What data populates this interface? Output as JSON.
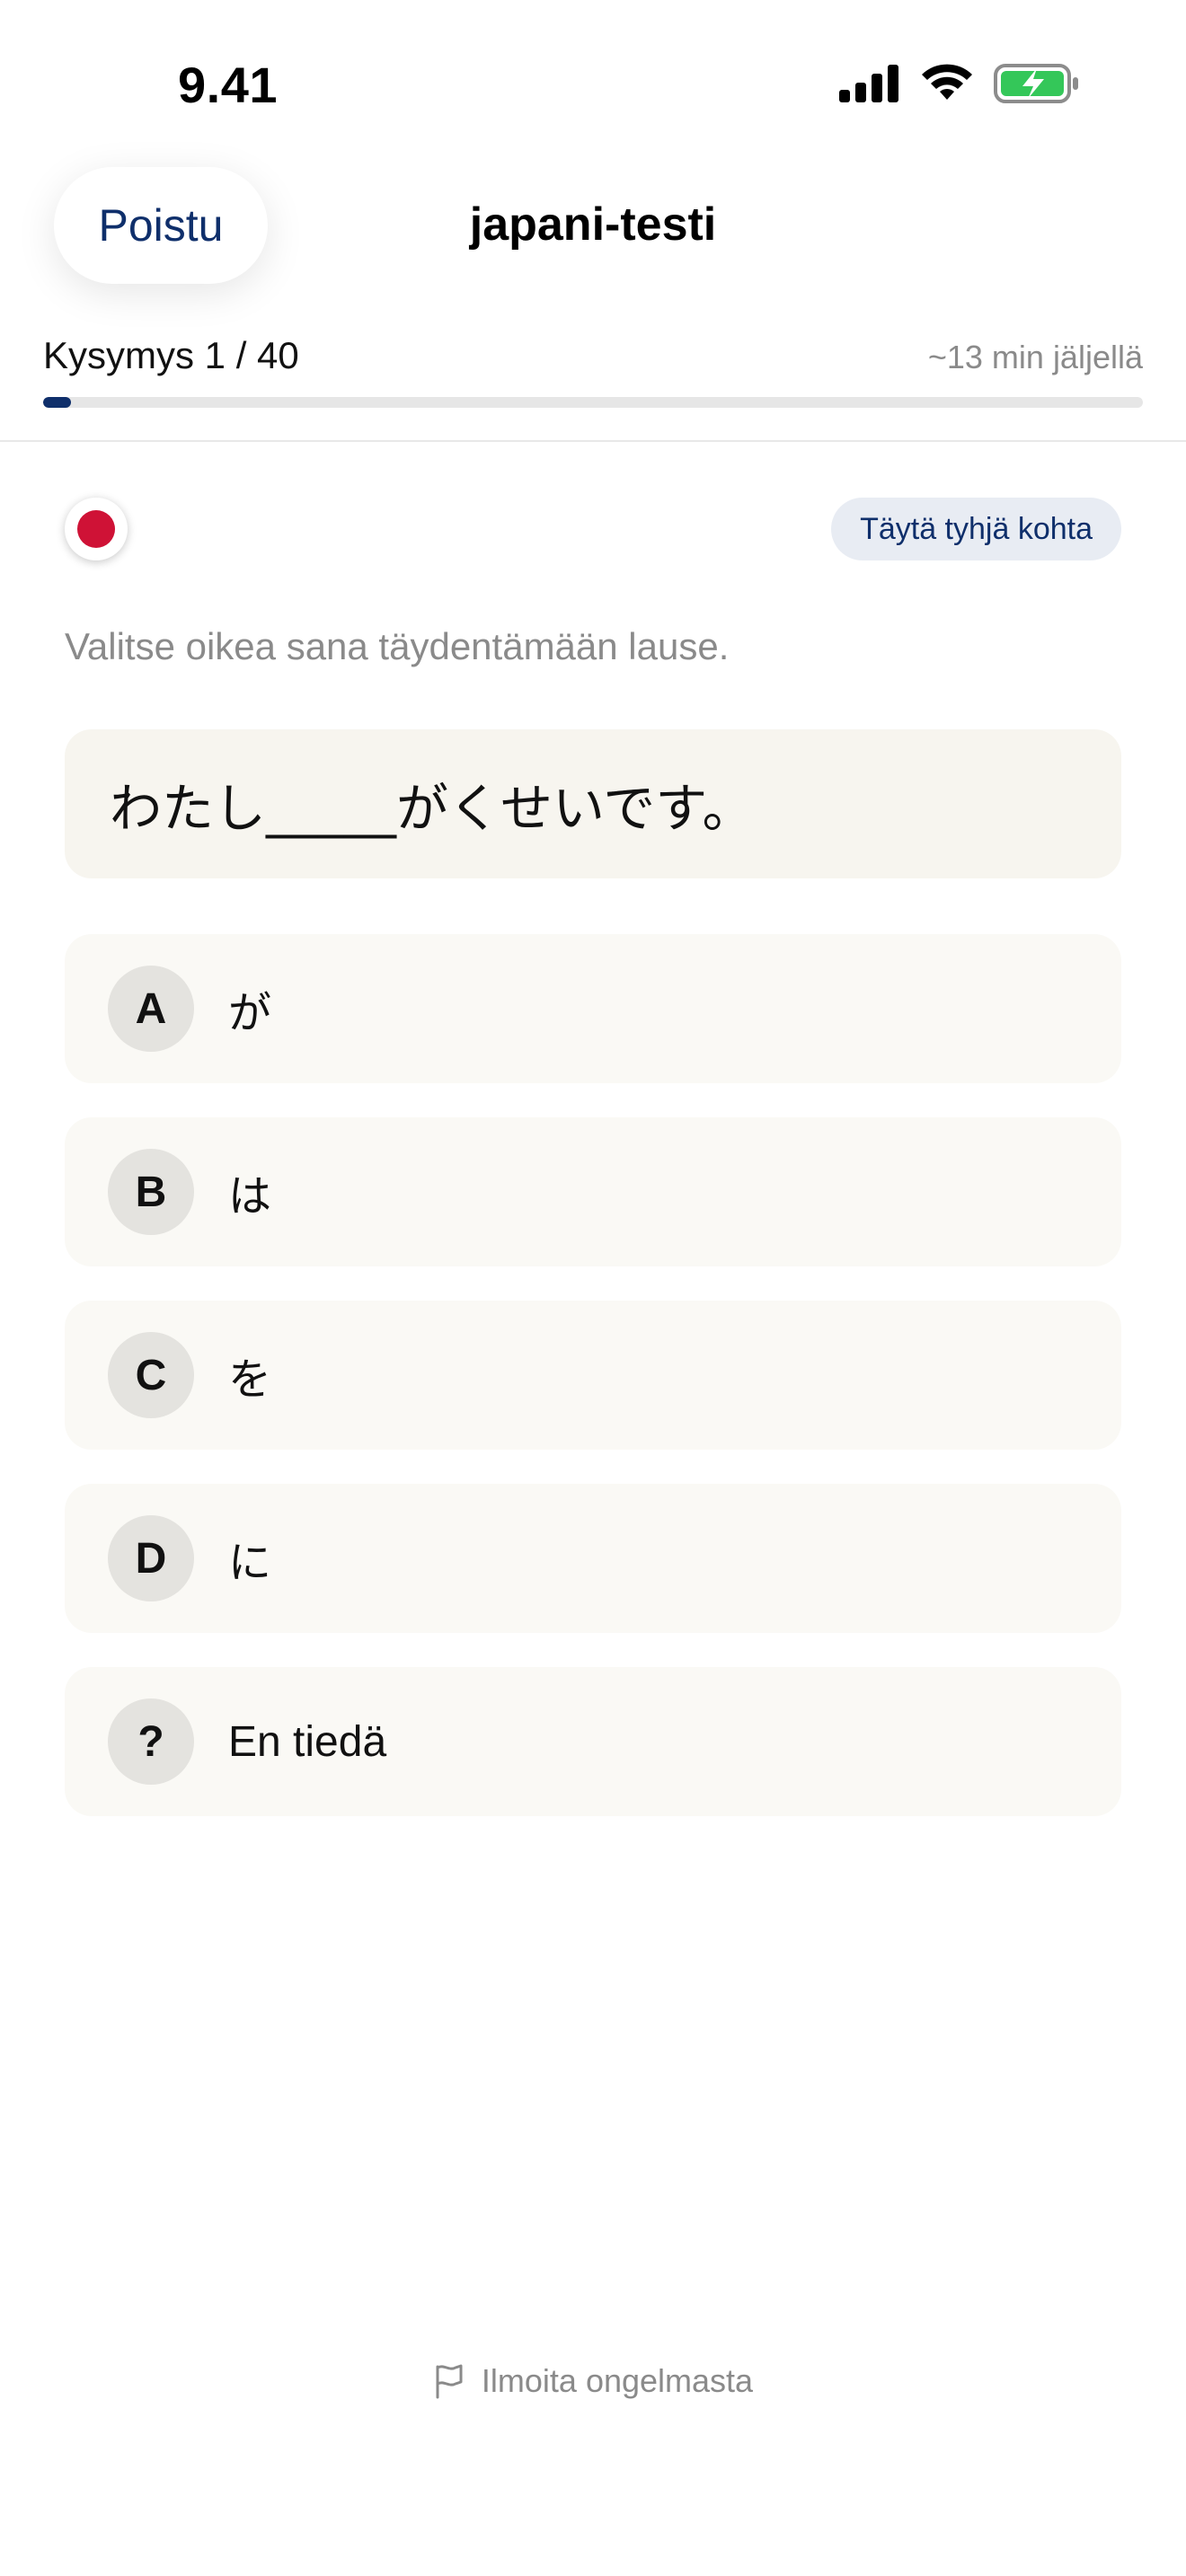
{
  "status_bar": {
    "time": "9.41",
    "icons": [
      "signal-icon",
      "wifi-icon",
      "battery-charging-icon"
    ],
    "battery_color": "#34c759"
  },
  "nav": {
    "exit_label": "Poistu",
    "title": "japani-testi"
  },
  "progress": {
    "counter": "Kysymys 1 / 40",
    "time_left": "~13 min jäljellä",
    "fraction": 0.025,
    "accent_color": "#0f2f6b"
  },
  "question": {
    "language_flag": "japan-flag-icon",
    "type_chip": "Täytä tyhjä kohta",
    "instruction": "Valitse oikea sana täydentämään lause.",
    "sentence": "わたし_____がくせいです。"
  },
  "options": [
    {
      "key": "A",
      "label": "が"
    },
    {
      "key": "B",
      "label": "は"
    },
    {
      "key": "C",
      "label": "を"
    },
    {
      "key": "D",
      "label": "に"
    },
    {
      "key": "?",
      "label": "En tiedä"
    }
  ],
  "footer": {
    "report_icon": "flag-outline-icon",
    "report_label": "Ilmoita ongelmasta"
  }
}
